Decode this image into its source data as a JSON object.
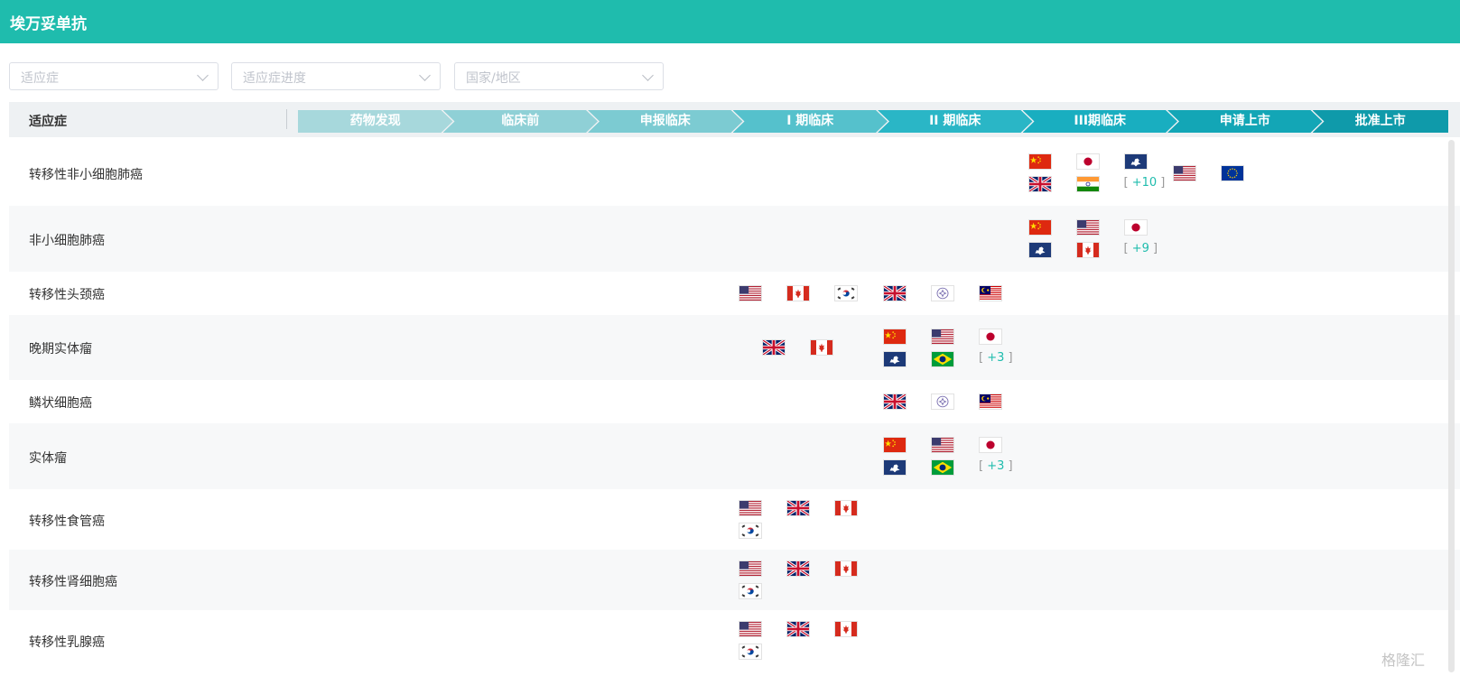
{
  "header": {
    "title": "埃万妥单抗"
  },
  "filters": [
    {
      "placeholder": "适应症"
    },
    {
      "placeholder": "适应症进度"
    },
    {
      "placeholder": "国家/地区"
    }
  ],
  "table": {
    "indication_header": "适应症",
    "stages": [
      {
        "label": "药物发现",
        "color": "#a7d8dc"
      },
      {
        "label": "临床前",
        "color": "#8fd0d6"
      },
      {
        "label": "申报临床",
        "color": "#7ccbd2"
      },
      {
        "label": "I 期临床",
        "color": "#55c1cc"
      },
      {
        "label": "II 期临床",
        "color": "#2ab6c6"
      },
      {
        "label": "III期临床",
        "color": "#19aec0"
      },
      {
        "label": "申请上市",
        "color": "#13a6b6"
      },
      {
        "label": "批准上市",
        "color": "#0f9aaa"
      }
    ],
    "rows": [
      {
        "label": "转移性非小细胞肺癌",
        "groups": [
          {
            "stage": 5,
            "flags": [
              "cn-flag",
              "jp-flag",
              "eu-map-flag",
              "gb-flag",
              "in-flag"
            ],
            "more": "+10"
          },
          {
            "stage": 6,
            "flags": [
              "us-flag",
              "eu-flag"
            ]
          }
        ]
      },
      {
        "label": "非小细胞肺癌",
        "groups": [
          {
            "stage": 5,
            "flags": [
              "cn-flag",
              "us-flag",
              "jp-flag",
              "eu-map-flag",
              "ca-flag"
            ],
            "more": "+9"
          }
        ]
      },
      {
        "label": "转移性头颈癌",
        "groups": [
          {
            "stage": 3,
            "flags": [
              "us-flag",
              "ca-flag",
              "kr-flag"
            ]
          },
          {
            "stage": 4,
            "flags": [
              "gb-flag",
              "tw-flag",
              "my-flag"
            ]
          }
        ]
      },
      {
        "label": "晚期实体瘤",
        "groups": [
          {
            "stage": 3,
            "offset": 26,
            "flags": [
              "gb-flag",
              "ca-flag"
            ]
          },
          {
            "stage": 4,
            "flags": [
              "cn-flag",
              "us-flag",
              "jp-flag",
              "eu-map-flag",
              "br-flag"
            ],
            "more": "+3"
          }
        ]
      },
      {
        "label": "鳞状细胞癌",
        "groups": [
          {
            "stage": 4,
            "flags": [
              "gb-flag",
              "tw-flag",
              "my-flag"
            ]
          }
        ]
      },
      {
        "label": "实体瘤",
        "groups": [
          {
            "stage": 4,
            "flags": [
              "cn-flag",
              "us-flag",
              "jp-flag",
              "eu-map-flag",
              "br-flag"
            ],
            "more": "+3"
          }
        ]
      },
      {
        "label": "转移性食管癌",
        "groups": [
          {
            "stage": 3,
            "flags": [
              "us-flag",
              "gb-flag",
              "ca-flag",
              "kr-flag"
            ]
          }
        ]
      },
      {
        "label": "转移性肾细胞癌",
        "groups": [
          {
            "stage": 3,
            "flags": [
              "us-flag",
              "gb-flag",
              "ca-flag",
              "kr-flag"
            ]
          }
        ]
      },
      {
        "label": "转移性乳腺癌",
        "groups": [
          {
            "stage": 3,
            "flags": [
              "us-flag",
              "gb-flag",
              "ca-flag",
              "kr-flag"
            ]
          }
        ]
      }
    ]
  },
  "watermark": "格隆汇"
}
